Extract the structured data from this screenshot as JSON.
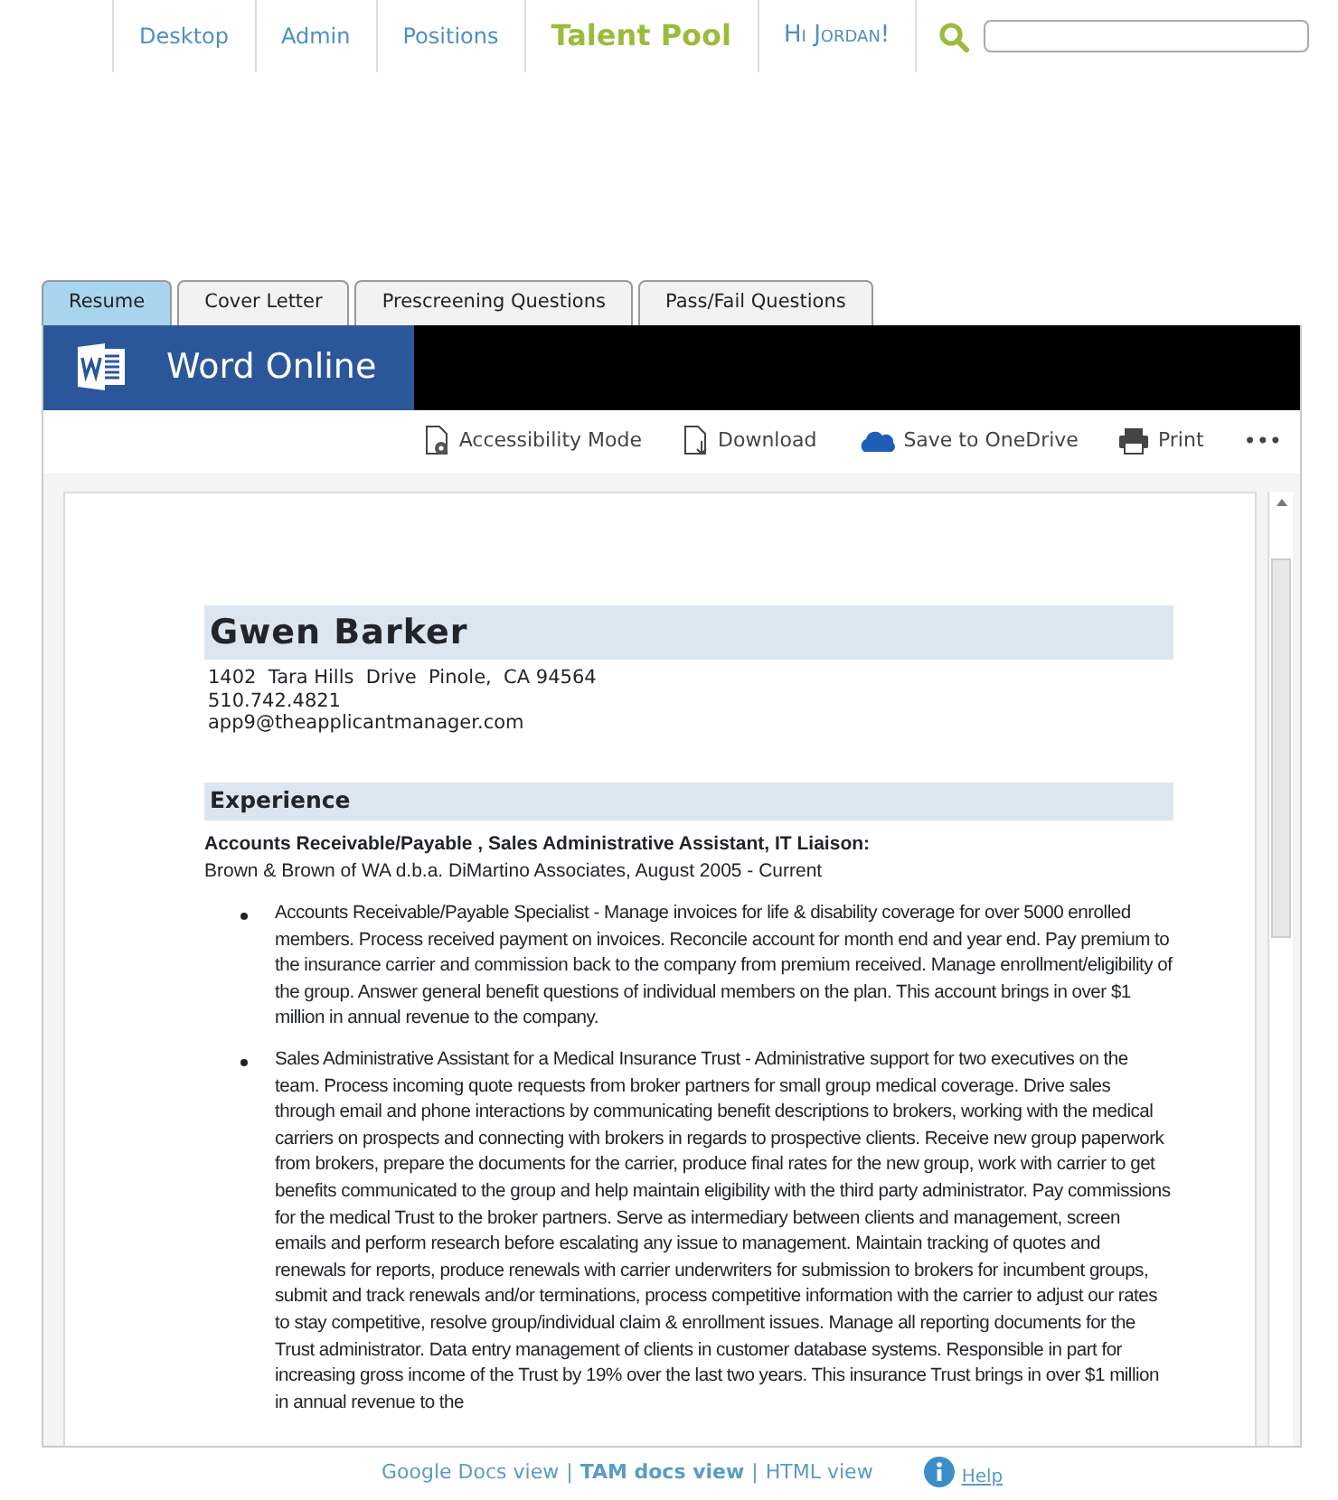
{
  "nav": {
    "items": [
      {
        "label": "Desktop",
        "kind": "link",
        "selected": false
      },
      {
        "label": "Admin",
        "kind": "link",
        "selected": false
      },
      {
        "label": "Positions",
        "kind": "link",
        "selected": false
      },
      {
        "label": "Talent Pool",
        "kind": "link",
        "selected": true
      },
      {
        "label": "Hi Jordan!",
        "kind": "greeting",
        "selected": false
      }
    ]
  },
  "tabs": [
    {
      "label": "Resume",
      "selected": true
    },
    {
      "label": "Cover Letter",
      "selected": false
    },
    {
      "label": "Prescreening Questions",
      "selected": false
    },
    {
      "label": "Pass/Fail Questions",
      "selected": false
    }
  ],
  "app": {
    "title": "Word Online"
  },
  "toolbar": [
    {
      "kind": "accessibility",
      "label": "Accessibility Mode"
    },
    {
      "kind": "download",
      "label": "Download"
    },
    {
      "kind": "cloud",
      "label": "Save to OneDrive"
    },
    {
      "kind": "print",
      "label": "Print"
    },
    {
      "kind": "more",
      "label": "•••"
    }
  ],
  "document": {
    "name": "Gwen Barker",
    "contact": [
      "1402  Tara Hills  Drive  Pinole,  CA 94564",
      "510.742.4821",
      "app9@theapplicantmanager.com"
    ],
    "sections": [
      {
        "heading": "Experience",
        "entries": [
          {
            "title": "Accounts Receivable/Payable , Sales Administrative Assistant, IT Liaison:",
            "subtitle": "Brown & Brown of WA d.b.a. DiMartino Associates, August 2005 - Current",
            "bullets": [
              "Accounts Receivable/Payable Specialist - Manage invoices for life & disability coverage for over 5000 enrolled members. Process received payment on invoices.  Reconcile account for month end and year end.  Pay premium to the insurance carrier and commission back to the company from premium received. Manage enrollment/eligibility of the group.  Answer general benefit questions of individual members on the plan.  This account brings in over $1 million in annual revenue to the company.",
              "Sales Administrative Assistant for a Medical Insurance Trust - Administrative support for two executives on the team.  Process incoming quote requests from broker partners for small group medical coverage. Drive sales through email and phone interactions by communicating benefit descriptions to brokers, working with the medical carriers on prospects and connecting with brokers in regards to prospective clients. Receive new group paperwork from brokers, prepare the documents for the carrier, produce final rates for the new group, work with carrier to get benefits communicated to the group and help maintain eligibility with the third party administrator. Pay commissions for the medical Trust to the broker partners.  Serve as intermediary between clients and management, screen emails and perform research before escalating any issue to management. Maintain tracking of quotes and renewals for reports, produce renewals with carrier underwriters for submission to brokers for incumbent groups, submit and track renewals and/or terminations, process competitive information with the carrier to adjust our rates to stay competitive, resolve group/individual claim & enrollment issues. Manage all reporting documents for the Trust administrator. Data entry management of clients in customer database systems. Responsible in part for increasing gross income of the Trust by 19% over the last two years.  This insurance Trust brings in over $1 million in annual revenue to the"
            ]
          }
        ]
      }
    ]
  },
  "footer": {
    "items": [
      {
        "kind": "link",
        "label": "Google Docs view",
        "selected": false
      },
      {
        "kind": "separator",
        "label": "|"
      },
      {
        "kind": "link",
        "label": "TAM docs view",
        "selected": true
      },
      {
        "kind": "separator",
        "label": "|"
      },
      {
        "kind": "link",
        "label": "HTML view",
        "selected": false
      }
    ],
    "help": "Help"
  }
}
